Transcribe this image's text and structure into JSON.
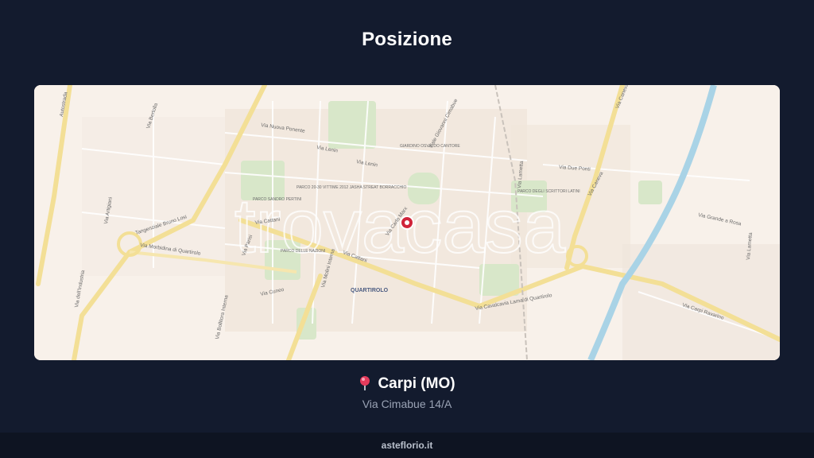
{
  "header": {
    "title": "Posizione"
  },
  "map": {
    "watermark": "trovacasa",
    "labels": {
      "via_nuova_ponente": "Via Nuova Ponente",
      "via_lenin_1": "Via Lenin",
      "via_lenin_2": "Via Lenin",
      "via_giovanni_cimabue": "Viale Giovanni Cimabue",
      "giardino": "GIARDINO OSVALDO CANTORE",
      "via_due_ponti": "Via Due Ponti",
      "via_caneva_1": "Via Caneva",
      "via_caneva_2": "Via Caneva",
      "via_cattani_1": "Via Cattani",
      "via_cattani_2": "Via Cattani",
      "parco_sandro": "PARCO SANDRO PERTINI",
      "parco_vittime": "PARCO 20-30 VITTIME 2012 JASHA STREAT BORRACCHIO",
      "parco_scrittori": "PARCO DEGLI SCRITTORI LATINI",
      "parco_nazioni": "PARCO DELLE NAZIONI",
      "quartirolo": "QUARTIROLO",
      "via_cavalcavia": "Via Cavalcavia Lama di Quartirolo",
      "via_carpi_ravarino": "Via Carpi Ravarino",
      "via_grande_rosa": "Via Grande a Rosa",
      "via_lametta": "Via Lametta",
      "via_industria": "Via dell'Industria",
      "tangenziale": "Tangenziale Bruno Losi",
      "via_morbidina": "Via Morbidina di Quartirolo",
      "via_molini": "Via Molini Interna",
      "via_cuneo": "Via Cuneo",
      "via_bollitora": "Via Bollitora Interna",
      "via_bertolla": "Via Bertolla",
      "via_artigiani": "Via Artigiani",
      "autostrada": "Autostrada",
      "via_parisi": "Via Parisi",
      "via_luigi_carlo_marx": "Via Carlo Marx",
      "via_loro_ti": "Via Lametta"
    }
  },
  "location": {
    "city": "Carpi (MO)",
    "address": "Via Cimabue 14/A",
    "pin_icon": "round-pushpin"
  },
  "footer": {
    "brand": "asteflorio.it"
  },
  "colors": {
    "background": "#131b2e",
    "map_base": "#f8f1ea",
    "park": "#d7e8c8",
    "road_major": "#f3df96",
    "water": "#a9d3e6",
    "marker": "#d0243a"
  }
}
